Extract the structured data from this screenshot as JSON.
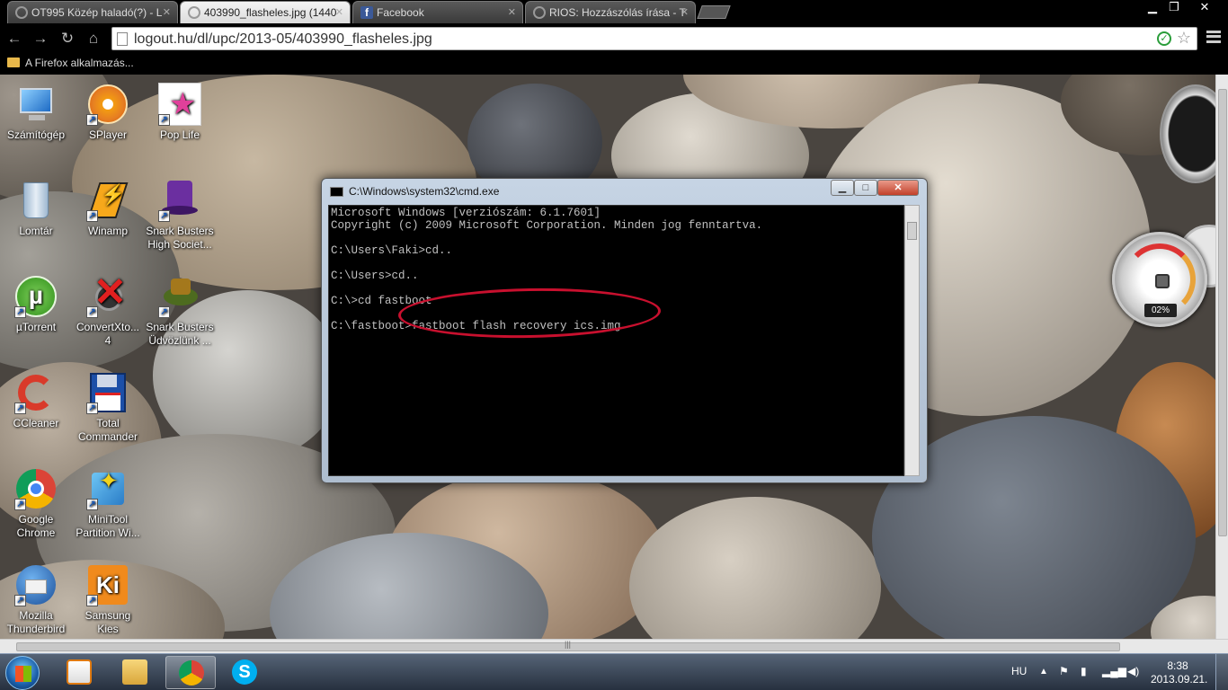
{
  "browser": {
    "tabs": [
      {
        "label": "OT995 Közép haladó(?) - L",
        "favicon": "loading-icon"
      },
      {
        "label": "403990_flasheles.jpg (1440",
        "favicon": "loading-icon",
        "active": true
      },
      {
        "label": "Facebook",
        "favicon": "facebook-icon"
      },
      {
        "label": "RIOS: Hozzászólás írása - T",
        "favicon": "loading-icon"
      }
    ],
    "url": "logout.hu/dl/upc/2013-05/403990_flasheles.jpg",
    "bookmark_folder": "A Firefox alkalmazás..."
  },
  "desktop_icons": [
    {
      "label": "Számítógép",
      "icon": "computer-icon"
    },
    {
      "label": "SPlayer",
      "icon": "splayer-icon"
    },
    {
      "label": "Pop Life",
      "icon": "pop-life-icon"
    },
    {
      "label": "Lomtár",
      "icon": "recycle-bin-icon"
    },
    {
      "label": "Winamp",
      "icon": "winamp-icon"
    },
    {
      "label": "Snark Busters High Societ...",
      "icon": "snark-busters-icon"
    },
    {
      "label": "µTorrent",
      "icon": "utorrent-icon"
    },
    {
      "label": "ConvertXto... 4",
      "icon": "convertxto-icon"
    },
    {
      "label": "Snark Busters Üdvözlünk ...",
      "icon": "snark-busters-2-icon"
    },
    {
      "label": "CCleaner",
      "icon": "ccleaner-icon"
    },
    {
      "label": "Total Commander",
      "icon": "total-commander-icon"
    },
    {
      "label": "Google Chrome",
      "icon": "chrome-icon"
    },
    {
      "label": "MiniTool Partition Wi...",
      "icon": "minitool-icon"
    },
    {
      "label": "Mozilla Thunderbird",
      "icon": "thunderbird-icon"
    },
    {
      "label": "Samsung Kies",
      "icon": "samsung-kies-icon"
    }
  ],
  "cmd": {
    "title": "C:\\Windows\\system32\\cmd.exe",
    "lines": [
      "Microsoft Windows [verziószám: 6.1.7601]",
      "Copyright (c) 2009 Microsoft Corporation. Minden jog fenntartva.",
      "",
      "C:\\Users\\Faki>cd..",
      "",
      "C:\\Users>cd..",
      "",
      "C:\\>cd fastboot",
      "",
      "C:\\fastboot>fastboot flash recovery ics.img"
    ],
    "highlight_color": "#c8102e"
  },
  "gadgets": {
    "cpu_meter_value": "02%"
  },
  "taskbar": {
    "language": "HU",
    "time": "8:38",
    "date": "2013.09.21.",
    "pinned": [
      "media-player-icon",
      "explorer-icon",
      "chrome-icon",
      "skype-icon"
    ],
    "active_index": 2
  }
}
